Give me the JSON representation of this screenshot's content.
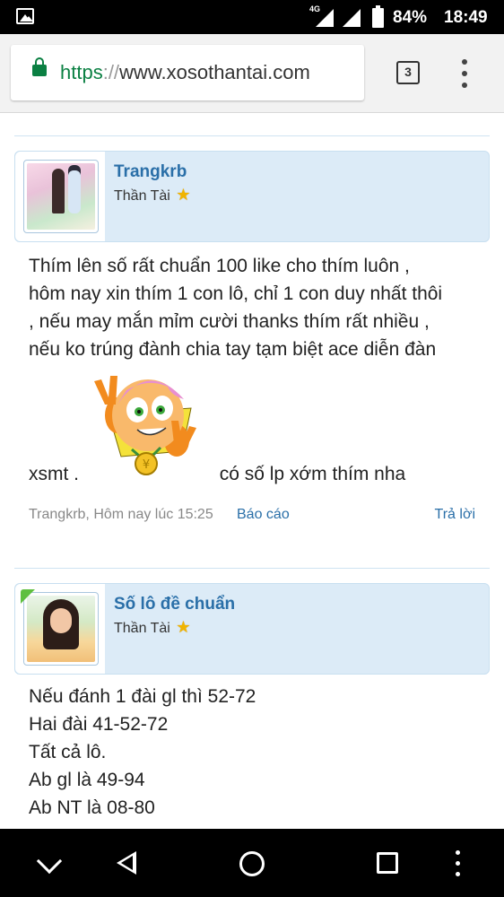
{
  "status_bar": {
    "network_type": "4G",
    "battery_percent": "84%",
    "time": "18:49"
  },
  "browser": {
    "url_scheme": "https",
    "url_separator": "://",
    "url_host": "www.xosothantai.com",
    "tab_count": "3"
  },
  "posts": [
    {
      "username": "Trangkrb",
      "user_title": "Thần Tài",
      "message_lines": [
        "Thím lên số rất chuẩn 100 like cho thím luôn ,",
        "hôm nay xin thím 1 con lô, chỉ 1 con duy nhất thôi",
        ", nếu may mắn mỉm cười thanks thím rất nhiều ,",
        "nếu ko trúng đành chia tay tạm biệt ace diễn đàn"
      ],
      "message_before_smiley": "xsmt .",
      "message_after_smiley": "có số lp xớm thím nha",
      "meta": "Trangkrb, Hôm nay lúc 15:25",
      "report_label": "Báo cáo",
      "reply_label": "Trả lời"
    },
    {
      "username": "Số lô đề chuẩn",
      "user_title": "Thần Tài",
      "message_lines": [
        "Nếu đánh 1 đài gl thì 52-72",
        "Hai đài 41-52-72",
        "Tất cả lô.",
        "Ab gl là 49-94",
        "Ab NT là 08-80"
      ]
    }
  ],
  "icons": {
    "gallery": "image-icon",
    "lock": "lock-icon",
    "star": "star-icon",
    "smiley": "victory-smiley-icon"
  },
  "colors": {
    "accent_link": "#2a6fa8",
    "user_card_bg": "#dcebf7",
    "secure_green": "#0b8043",
    "star": "#f0b400"
  }
}
